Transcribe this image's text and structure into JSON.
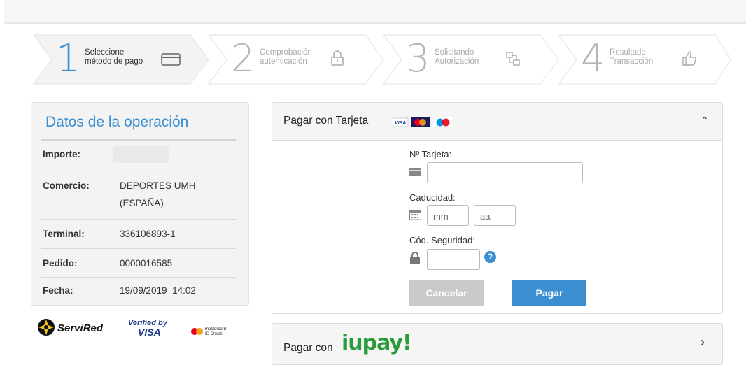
{
  "steps": [
    {
      "number": "1",
      "label_line1": "Seleccione",
      "label_line2": "método de pago",
      "icon": "credit-card-icon",
      "state": "active"
    },
    {
      "number": "2",
      "label_line1": "Comprobación",
      "label_line2": "autenticación",
      "icon": "lock-icon",
      "state": "inactive"
    },
    {
      "number": "3",
      "label_line1": "Solicitando",
      "label_line2": "Autorización",
      "icon": "network-icon",
      "state": "inactive"
    },
    {
      "number": "4",
      "label_line1": "Resultado",
      "label_line2": "Transacción",
      "icon": "thumbs-up-icon",
      "state": "inactive"
    }
  ],
  "operation": {
    "title": "Datos de la operación",
    "rows": [
      {
        "key": "Importe:",
        "value": ""
      },
      {
        "key": "Comercio:",
        "value": "DEPORTES UMH (ESPAÑA)"
      },
      {
        "key": "Terminal:",
        "value": "336106893-1"
      },
      {
        "key": "Pedido:",
        "value": "0000016585"
      },
      {
        "key": "Fecha:",
        "value": "19/09/2019  14:02"
      }
    ]
  },
  "logos": {
    "servired": "ServiRed",
    "verified_line1": "Verified by",
    "verified_line2": "VISA",
    "mc_line1": "mastercard",
    "mc_line2": "ID Check"
  },
  "card_payment": {
    "title": "Pagar con Tarjeta",
    "brands": {
      "visa": "VISA",
      "mastercard": "MC",
      "maestro": "Maestro"
    },
    "card_number_label": "Nº Tarjeta:",
    "card_number_value": "",
    "expiry_label": "Caducidad:",
    "month_placeholder": "mm",
    "year_placeholder": "aa",
    "cvv_label": "Cód. Seguridad:",
    "cvv_value": "",
    "help_symbol": "?",
    "cancel_label": "Cancelar",
    "pay_label": "Pagar",
    "collapse_symbol": "⌃"
  },
  "iupay_payment": {
    "title": "Pagar con",
    "brand": "iupay!",
    "expand_symbol": "›"
  },
  "colors": {
    "accent": "#3b8fd0",
    "cancel_bg": "#c9c9c9",
    "iupay_green": "#2a9b3a"
  }
}
